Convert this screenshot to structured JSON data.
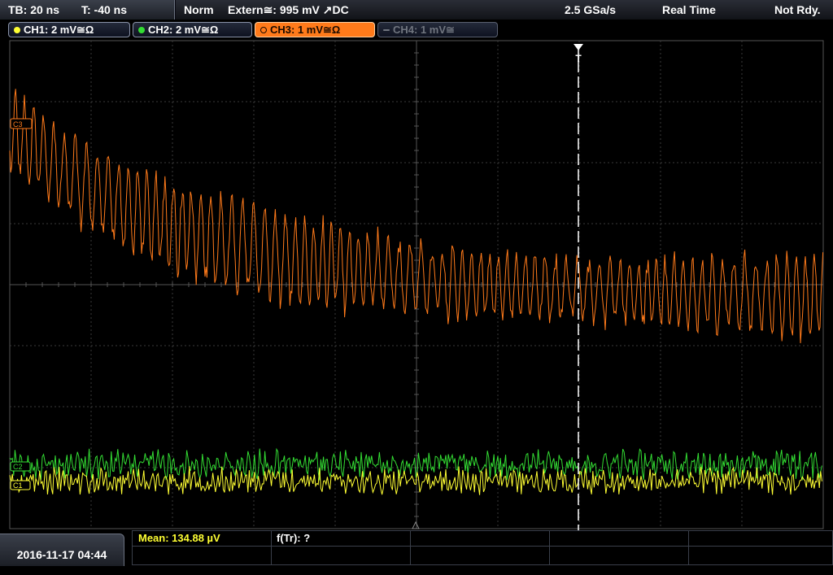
{
  "topbar": {
    "timebase": "TB: 20 ns",
    "trigger_time": "T: -40 ns",
    "trigger_mode": "Norm",
    "trigger_source": "Extern≅: 995 mV ↗DC",
    "sample_rate": "2.5 GSa/s",
    "acq_mode": "Real Time",
    "status": "Not Rdy."
  },
  "channels": [
    {
      "label": "CH1: 2 mV≅Ω",
      "color": "#ffff33",
      "active": true
    },
    {
      "label": "CH2: 2 mV≅Ω",
      "color": "#33dd33",
      "active": true
    },
    {
      "label": "CH3: 1 mV≅Ω",
      "color": "#ff7a1a",
      "active": true,
      "selected": true
    },
    {
      "label": "CH4: 1 mV≅",
      "color": "#70757f",
      "active": false
    }
  ],
  "markers": {
    "ch3_marker": "C3",
    "ch2_marker": "C2",
    "ch1_marker": "C1",
    "trigger_marker": "T"
  },
  "bottom": {
    "datetime": "2016-11-17 04:44",
    "mean": "Mean: 134.88 µV",
    "f_tr": "f(Tr): ?"
  },
  "colors": {
    "ch1": "#ffff33",
    "ch2": "#33dd33",
    "ch3": "#ff7a1a",
    "grid": "#3a3a3a",
    "trigger_line": "#ffffff"
  }
}
